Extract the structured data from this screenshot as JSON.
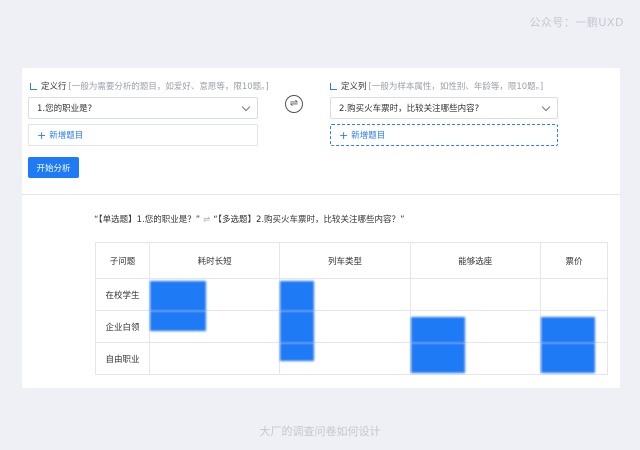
{
  "watermark": "公众号：一鹏UXD",
  "caption": "大厂的调查问卷如何设计",
  "row_definition": {
    "title": "定义行",
    "hint": "[一般为需要分析的题目，如爱好、意愿等，限10题。]",
    "selected": "1.您的职业是?",
    "add_label": "新增题目"
  },
  "col_definition": {
    "title": "定义列",
    "hint": "[一般为样本属性，如性别、年龄等，限10题。]",
    "selected": "2.购买火车票时，比较关注哪些内容?",
    "add_label": "新增题目"
  },
  "swap_icon": "swap-icon",
  "analyze_button": "开始分析",
  "summary": {
    "left": "“【单选题】1.您的职业是？”",
    "arrow": "⇌",
    "right": "“【多选题】2.购买火车票时，比较关注哪些内容？”"
  },
  "table": {
    "headers": [
      "子问题",
      "耗时长短",
      "列车类型",
      "能够选座",
      "票价"
    ],
    "rows": [
      {
        "label": "在校学生"
      },
      {
        "label": "企业白领"
      },
      {
        "label": "自由职业"
      }
    ]
  },
  "colors": {
    "accent": "#1f7af6"
  }
}
